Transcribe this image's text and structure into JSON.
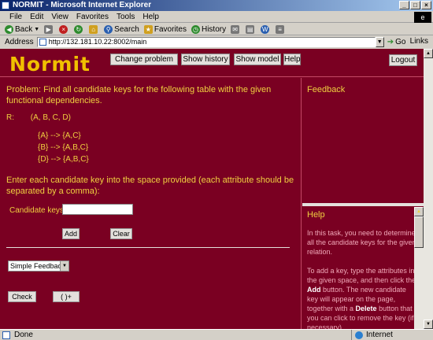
{
  "window": {
    "title": "NORMIT - Microsoft Internet Explorer",
    "controls": [
      "_",
      "□",
      "×"
    ]
  },
  "menubar": {
    "items": [
      "File",
      "Edit",
      "View",
      "Favorites",
      "Tools",
      "Help"
    ]
  },
  "toolbar": {
    "back": "Back",
    "search": "Search",
    "favorites": "Favorites",
    "history": "History"
  },
  "addressbar": {
    "label": "Address",
    "url": "http://132.181.10.22:8002/main",
    "go": "Go",
    "links": "Links"
  },
  "header": {
    "logo": "Normit",
    "nav": [
      "Change problem",
      "Show history",
      "Show model",
      "Help"
    ],
    "logout": "Logout"
  },
  "problem": {
    "statement": "Problem: Find all candidate keys for the following table with the given functional dependencies.",
    "relation_label": "R:",
    "relation": "(A, B, C, D)",
    "dependencies": [
      "{A} --> {A,C}",
      "{B} --> {A,B,C}",
      "{D} --> {A,B,C}"
    ],
    "instruction": "Enter each candidate key into the space provided (each attribute should be separated by a comma):",
    "candidate_label": "Candidate keys:",
    "candidate_value": "",
    "add_label": "Add",
    "clear_label": "Clear",
    "feedback_option": "Simple Feedback",
    "check_label": "Check",
    "next_label": "(    )+"
  },
  "side": {
    "feedback_title": "Feedback",
    "help_title": "Help",
    "help_p1": "In this task, you need to determine all the candidate keys for the given relation.",
    "help_p2a": "To add a key, type the attributes in the given space, and then click the ",
    "help_p2_add": "Add",
    "help_p2b": " button. The new candidate key will appear on the page, together with a ",
    "help_p2_delete": "Delete",
    "help_p2c": " button that you can click to remove the key (if necessary)."
  },
  "status": {
    "text": "Done",
    "zone": "Internet"
  }
}
